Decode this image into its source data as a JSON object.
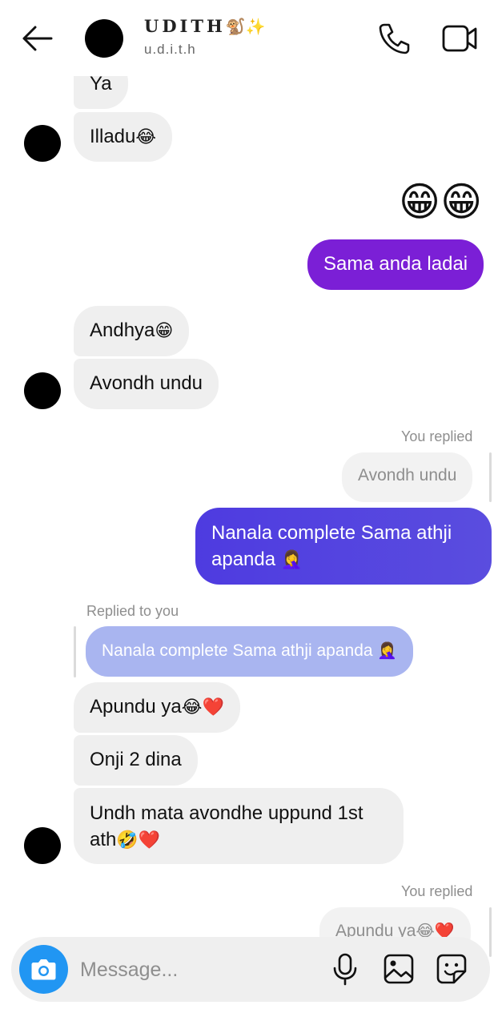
{
  "header": {
    "name": "UDITH",
    "name_emoji": "🐒✨",
    "username": "u.d.i.t.h"
  },
  "messages": {
    "m1": "Ya",
    "m2": "Illadu",
    "m3": "Sama anda ladai",
    "m4": "Andhya",
    "m5": "Avondh undu",
    "replied1_label": "You replied",
    "replied1_quote": "Avondh undu",
    "m6": "Nanala complete Sama athji apanda",
    "replied2_label": "Replied to you",
    "replied2_quote": "Nanala complete Sama athji apanda",
    "m7": "Apundu ya",
    "m8": "Onji 2 dina",
    "m9": "Undh mata avondhe uppund 1st ath",
    "replied3_label": "You replied",
    "replied3_quote": "Apundu ya"
  },
  "composer": {
    "placeholder": "Message..."
  },
  "colors": {
    "outgoing_purple": "#7b1fd6",
    "outgoing_blue": "#5a45df",
    "quote_blue": "#a9b5f0",
    "camera_blue": "#2196f3"
  }
}
